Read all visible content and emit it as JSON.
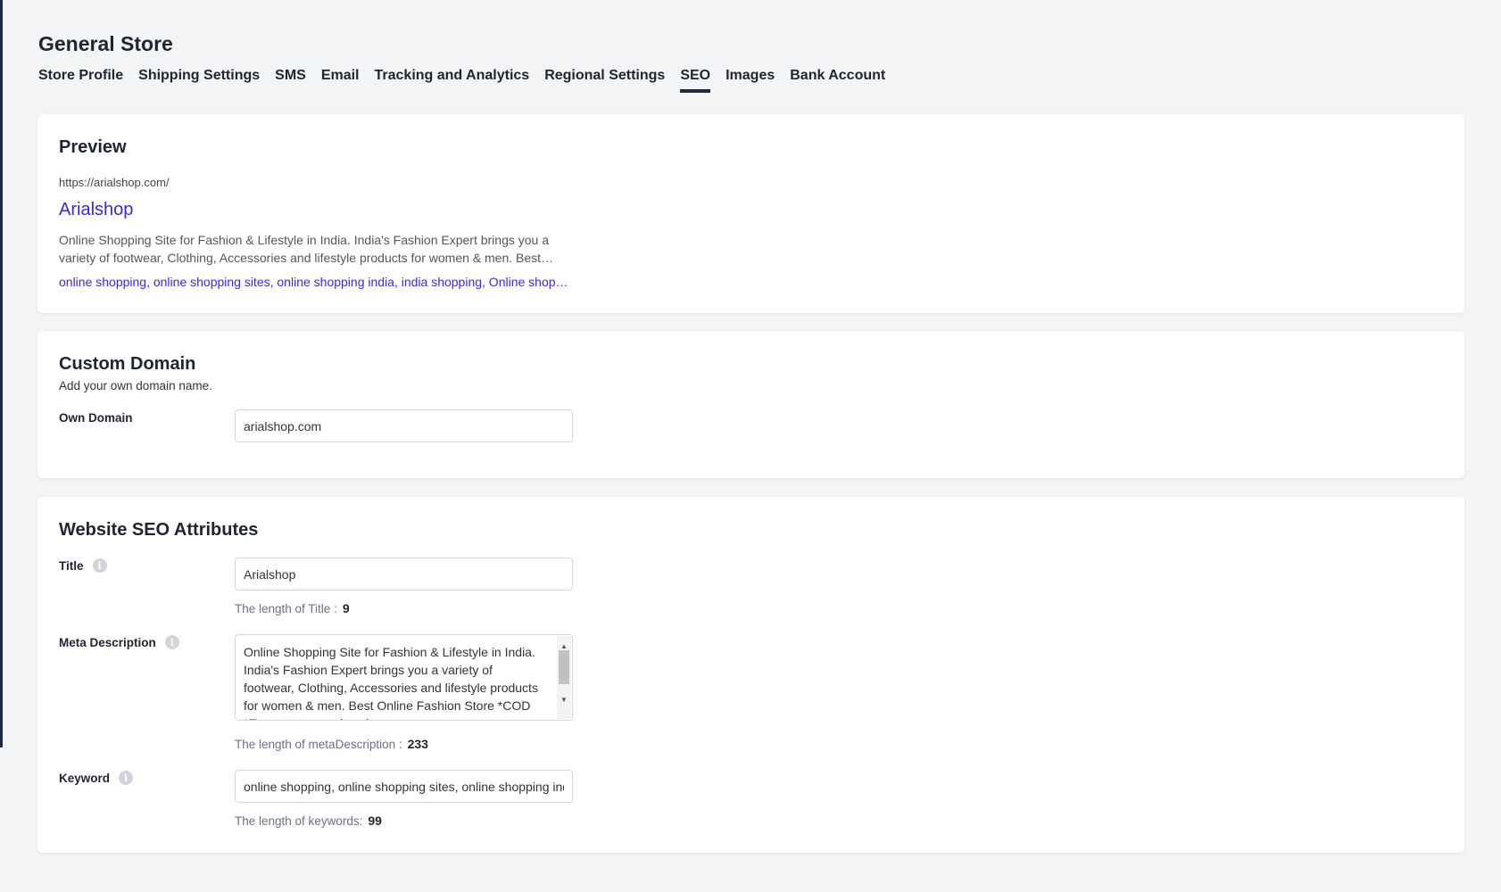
{
  "page_title": "General Store",
  "tabs": [
    {
      "label": "Store Profile"
    },
    {
      "label": "Shipping Settings"
    },
    {
      "label": "SMS"
    },
    {
      "label": "Email"
    },
    {
      "label": "Tracking and Analytics"
    },
    {
      "label": "Regional Settings"
    },
    {
      "label": "SEO",
      "active": true
    },
    {
      "label": "Images"
    },
    {
      "label": "Bank Account"
    }
  ],
  "preview": {
    "heading": "Preview",
    "url": "https://arialshop.com/",
    "title": "Arialshop",
    "description": "Online Shopping Site for Fashion & Lifestyle in India. India's Fashion Expert brings you a variety of footwear, Clothing, Accessories and lifestyle products for women & men. Best…",
    "keywords": "online shopping, online shopping sites, online shopping india, india shopping, Online shop…"
  },
  "custom_domain": {
    "heading": "Custom Domain",
    "subtitle": "Add your own domain name.",
    "own_domain_label": "Own Domain",
    "own_domain_value": "arialshop.com"
  },
  "seo": {
    "heading": "Website SEO Attributes",
    "title_label": "Title",
    "title_value": "Arialshop",
    "title_length_label": "The length of Title :",
    "title_length": "9",
    "meta_label": "Meta Description",
    "meta_value": "Online Shopping Site for Fashion & Lifestyle in India. India's Fashion Expert brings you a variety of footwear, Clothing, Accessories and lifestyle products for women & men. Best Online Fashion Store *COD *Easy returns and exchanges",
    "meta_length_label": "The length of metaDescription :",
    "meta_length": "233",
    "keyword_label": "Keyword",
    "keyword_value": "online shopping, online shopping sites, online shopping india, india shopping, Online shopping",
    "keyword_length_label": "The length of keywords:",
    "keyword_length": "99"
  },
  "colors": {
    "accent": "#1e2a3f",
    "link": "#3a2bc2"
  }
}
